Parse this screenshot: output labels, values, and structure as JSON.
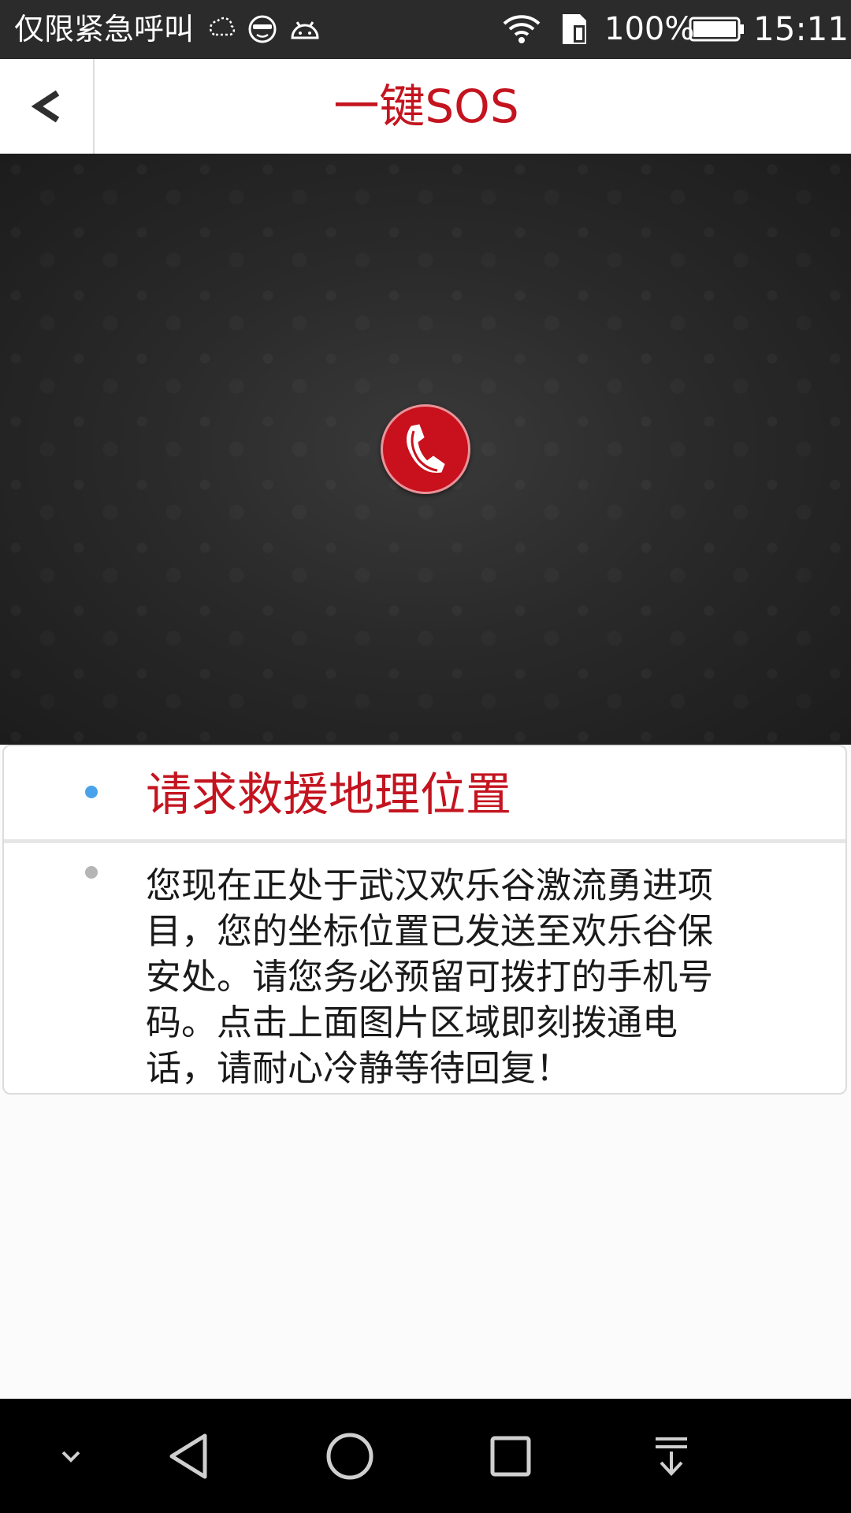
{
  "status_bar": {
    "carrier_text": "仅限紧急呼叫",
    "battery_percent": "100%",
    "time": "15:11",
    "icons": [
      "weather-icon",
      "face-icon",
      "android-icon",
      "wifi-icon",
      "sim-icon",
      "battery-icon"
    ]
  },
  "header": {
    "title": "一键SOS",
    "back_icon": "chevron-left-icon"
  },
  "banner": {
    "call_icon": "phone-icon"
  },
  "panel": {
    "title": "请求救援地理位置",
    "body": "您现在正处于武汉欢乐谷激流勇进项目，您的坐标位置已发送至欢乐谷保安处。请您务必预留可拨打的手机号码。点击上面图片区域即刻拨通电话，请耐心冷静等待回复！"
  },
  "nav_bar": {
    "icons": [
      "hide-nav-icon",
      "back-triangle-icon",
      "home-circle-icon",
      "recents-square-icon",
      "notification-pull-icon"
    ]
  },
  "colors": {
    "accent": "#c4141f",
    "dot_active": "#4aa3ea",
    "dot_inactive": "#b5b5b5"
  }
}
